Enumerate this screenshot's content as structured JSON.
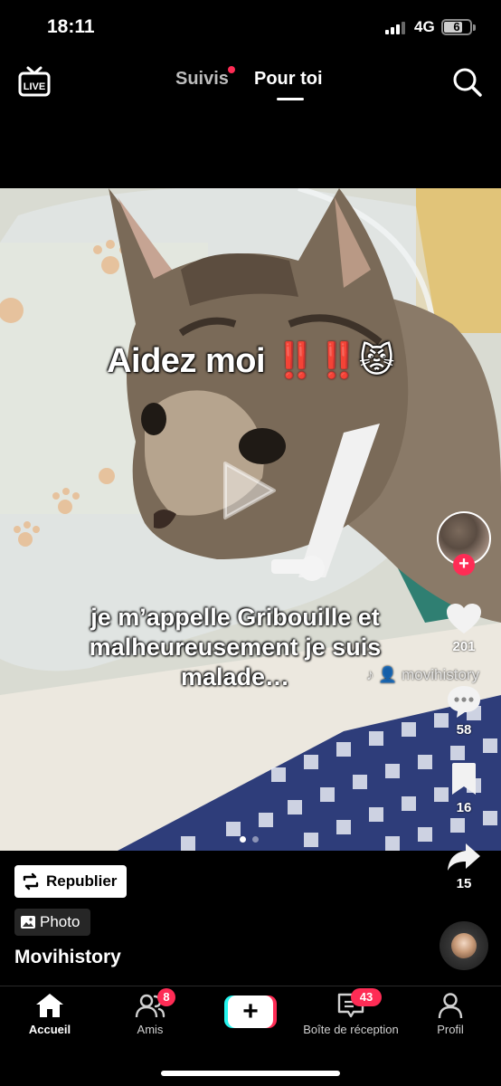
{
  "status_bar": {
    "time": "18:11",
    "network": "4G",
    "battery": "6"
  },
  "top_nav": {
    "live_label": "LIVE",
    "tabs": [
      {
        "label": "Suivis",
        "active": false,
        "has_dot": true
      },
      {
        "label": "Pour toi",
        "active": true
      }
    ]
  },
  "post": {
    "headline": "Aidez moi",
    "headline_mark": "‼️‼️",
    "headline_emoji": "😾",
    "caption_lines": [
      "je m’appelle Gribouille et",
      "malheureusement je suis",
      "malade…"
    ],
    "watermark": "movihistory",
    "carousel": {
      "count": 2,
      "current": 1
    }
  },
  "actions": {
    "likes": "201",
    "comments": "58",
    "saves": "16",
    "shares": "15"
  },
  "footer": {
    "republish_label": "Republier",
    "photo_label": "Photo",
    "username": "Movihistory"
  },
  "bottom_nav": {
    "home": "Accueil",
    "friends": "Amis",
    "friends_badge": "8",
    "inbox": "Boîte de réception",
    "inbox_badge": "43",
    "profile": "Profil"
  },
  "colors": {
    "accent": "#fe2c55",
    "cyan": "#25f4ee",
    "background": "#000000"
  }
}
